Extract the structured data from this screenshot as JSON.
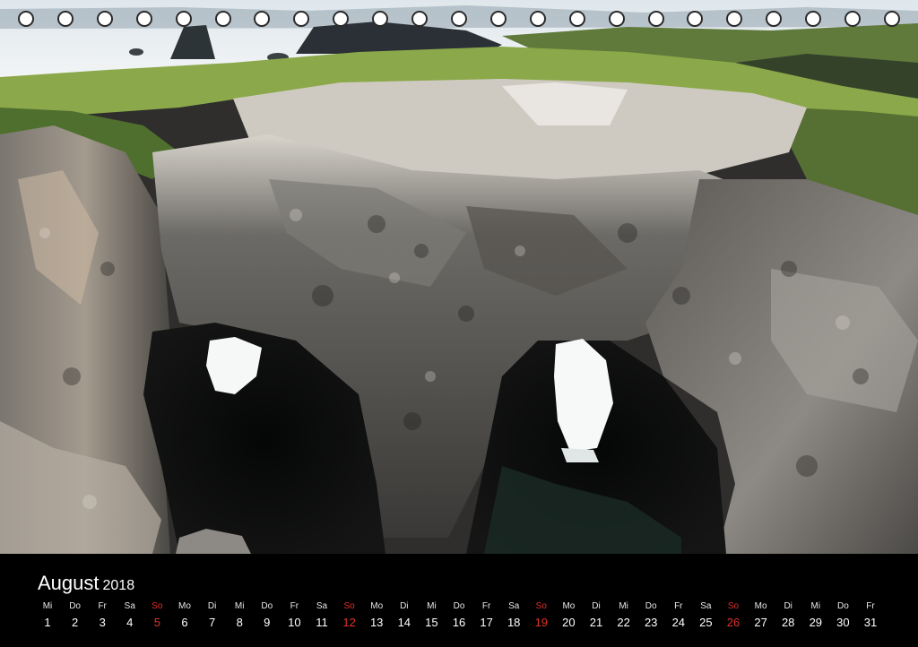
{
  "month": "August",
  "year": "2018",
  "ring_holes": 23,
  "colors": {
    "sunday": "#e0312c",
    "text": "#ffffff",
    "band": "#000000"
  },
  "days": [
    {
      "wd": "Mi",
      "d": "1"
    },
    {
      "wd": "Do",
      "d": "2"
    },
    {
      "wd": "Fr",
      "d": "3"
    },
    {
      "wd": "Sa",
      "d": "4"
    },
    {
      "wd": "So",
      "d": "5",
      "sunday": true
    },
    {
      "wd": "Mo",
      "d": "6"
    },
    {
      "wd": "Di",
      "d": "7"
    },
    {
      "wd": "Mi",
      "d": "8"
    },
    {
      "wd": "Do",
      "d": "9"
    },
    {
      "wd": "Fr",
      "d": "10"
    },
    {
      "wd": "Sa",
      "d": "11"
    },
    {
      "wd": "So",
      "d": "12",
      "sunday": true
    },
    {
      "wd": "Mo",
      "d": "13"
    },
    {
      "wd": "Di",
      "d": "14"
    },
    {
      "wd": "Mi",
      "d": "15"
    },
    {
      "wd": "Do",
      "d": "16"
    },
    {
      "wd": "Fr",
      "d": "17"
    },
    {
      "wd": "Sa",
      "d": "18"
    },
    {
      "wd": "So",
      "d": "19",
      "sunday": true
    },
    {
      "wd": "Mo",
      "d": "20"
    },
    {
      "wd": "Di",
      "d": "21"
    },
    {
      "wd": "Mi",
      "d": "22"
    },
    {
      "wd": "Do",
      "d": "23"
    },
    {
      "wd": "Fr",
      "d": "24"
    },
    {
      "wd": "Sa",
      "d": "25"
    },
    {
      "wd": "So",
      "d": "26",
      "sunday": true
    },
    {
      "wd": "Mo",
      "d": "27"
    },
    {
      "wd": "Di",
      "d": "28"
    },
    {
      "wd": "Mi",
      "d": "29"
    },
    {
      "wd": "Do",
      "d": "30"
    },
    {
      "wd": "Fr",
      "d": "31"
    }
  ]
}
